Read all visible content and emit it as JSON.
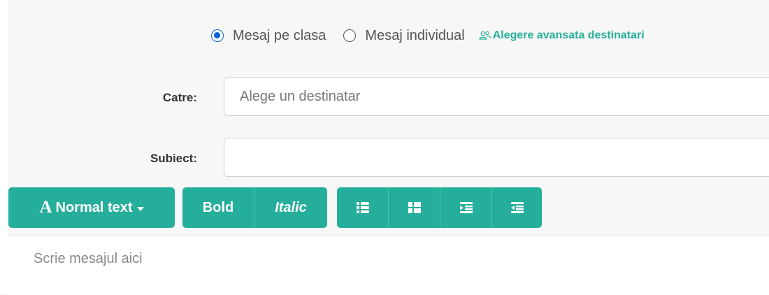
{
  "recipient_mode": {
    "options": [
      {
        "label": "Mesaj pe clasa",
        "selected": true
      },
      {
        "label": "Mesaj individual",
        "selected": false
      }
    ],
    "advanced_link": "Alegere avansata destinatari",
    "advanced_icon": "users-icon"
  },
  "form": {
    "to_label": "Catre:",
    "to_placeholder": "Alege un destinatar",
    "to_value": "",
    "subject_label": "Subiect:",
    "subject_placeholder": "",
    "subject_value": ""
  },
  "toolbar": {
    "style_icon": "A",
    "style_label": "Normal text",
    "bold_label": "Bold",
    "italic_label": "Italic",
    "list_buttons": [
      "unordered-list-icon",
      "ordered-list-icon",
      "outdent-icon",
      "indent-icon"
    ]
  },
  "editor": {
    "placeholder": "Scrie mesajul aici"
  },
  "colors": {
    "accent": "#26ae9c",
    "radio_checked": "#0b63d6"
  }
}
